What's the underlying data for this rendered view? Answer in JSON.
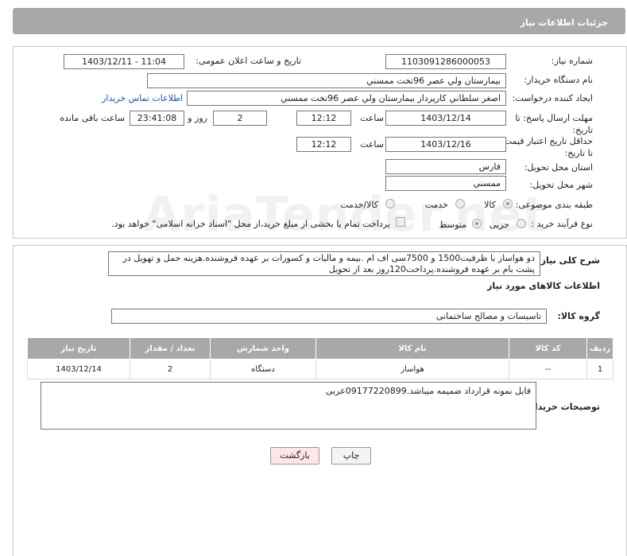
{
  "header": {
    "title": "جزئیات اطلاعات نیاز"
  },
  "watermark": "AriaTender.net",
  "form": {
    "need_number_label": "شماره نیاز:",
    "need_number": "1103091286000053",
    "announce_label": "تاریخ و ساعت اعلان عمومی:",
    "announce_value": "1403/12/11 - 11:04",
    "buyer_label": "نام دستگاه خریدار:",
    "buyer_value": "بیمارستان ولي عصر  96تخت ممسني",
    "creator_label": "ایجاد کننده درخواست:",
    "creator_value": "اصغر سلطاني کارپرداز بیمارستان ولي عصر  96تخت ممسني",
    "contact_link": "اطلاعات تماس خریدار",
    "deadline_label": "مهلت ارسال پاسخ: تا تاریخ:",
    "deadline_date": "1403/12/14",
    "time_label": "ساعت",
    "deadline_time": "12:12",
    "days_value": "2",
    "days_label": "روز و",
    "remaining_time": "23:41:08",
    "remaining_label": "ساعت باقی مانده",
    "validity_label": "حداقل تاریخ اعتبار قیمت: تا تاریخ:",
    "validity_date": "1403/12/16",
    "validity_time": "12:12",
    "province_label": "استان محل تحویل:",
    "province_value": "فارس",
    "city_label": "شهر محل تحویل:",
    "city_value": "ممسني",
    "category_label": "طبقه بندی موضوعی:",
    "category_options": [
      "کالا",
      "خدمت",
      "کالا/خدمت"
    ],
    "process_label": "نوع فرآیند خرید :",
    "process_options": [
      "جزیی",
      "متوسط"
    ],
    "payment_note": "پرداخت تمام یا بخشی از مبلغ خرید،از محل \"اسناد خزانه اسلامی\" خواهد بود."
  },
  "description": {
    "label": "شرح کلی نیاز:",
    "text": "دو هواساز با ظرفیت1500 و 7500سی اف ام .بیمه و مالیات و کسورات بر عهده فروشنده.هزینه حمل و تهویل در پشت بام بر عهده فروشنده.پرداخت120روز بعد از تحویل"
  },
  "goods_info_title": "اطلاعات کالاهای مورد نیاز",
  "goods_group": {
    "label": "گروه کالا:",
    "value": "تاسیسات و مصالح ساختمانی"
  },
  "table": {
    "headers": [
      "ردیف",
      "کد کالا",
      "نام کالا",
      "واحد شمارش",
      "تعداد / مقدار",
      "تاریخ نیاز"
    ],
    "rows": [
      [
        "1",
        "--",
        "هواساز",
        "دستگاه",
        "2",
        "1403/12/14"
      ]
    ]
  },
  "buyer_notes": {
    "label": "توضیحات خریدار:",
    "text": "فایل نمونه قرارداد ضمیمه میباشد.09177220899عربی"
  },
  "buttons": {
    "print": "چاپ",
    "back": "بازگشت"
  }
}
